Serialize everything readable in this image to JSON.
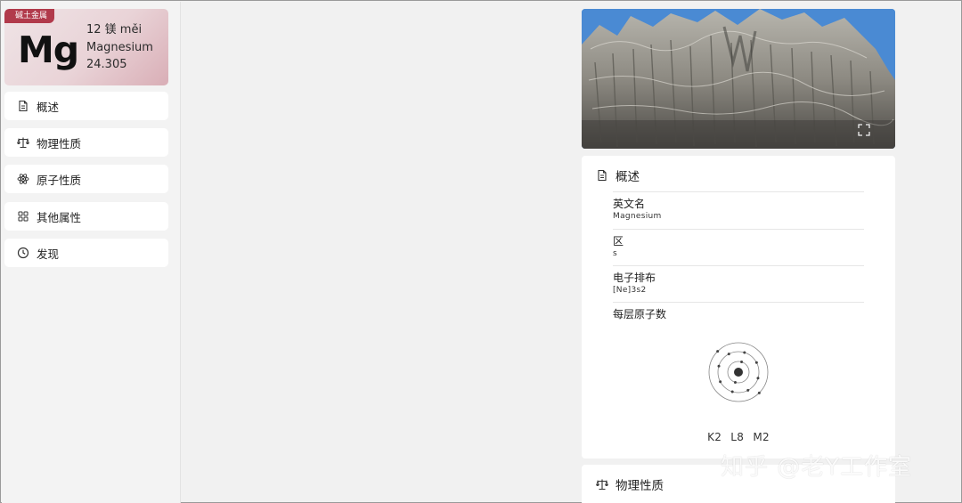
{
  "element": {
    "category": "碱土金属",
    "symbol": "Mg",
    "number_name": "12 镁 měi",
    "english_name": "Magnesium",
    "atomic_mass": "24.305"
  },
  "sidebar": {
    "items": [
      {
        "label": "概述",
        "icon": "document-icon"
      },
      {
        "label": "物理性质",
        "icon": "balance-scale-icon"
      },
      {
        "label": "原子性质",
        "icon": "atom-icon"
      },
      {
        "label": "其他属性",
        "icon": "grid-icon"
      },
      {
        "label": "发现",
        "icon": "clock-icon"
      }
    ]
  },
  "photo": {
    "fullscreen_icon": "fullscreen-icon"
  },
  "overview": {
    "title": "概述",
    "fields": [
      {
        "label": "英文名",
        "value": "Magnesium"
      },
      {
        "label": "区",
        "value": "s"
      },
      {
        "label": "电子排布",
        "value": "[Ne]3s2"
      },
      {
        "label": "每层原子数",
        "value": ""
      }
    ],
    "shells": [
      "K2",
      "L8",
      "M2"
    ]
  },
  "physical": {
    "title": "物理性质"
  },
  "watermark": "知乎 @老Y工作室",
  "colors": {
    "badge": "#b13a4b",
    "card_gradient_end": "#d9aeb6",
    "background": "#f1f1f1",
    "panel": "#ffffff"
  }
}
